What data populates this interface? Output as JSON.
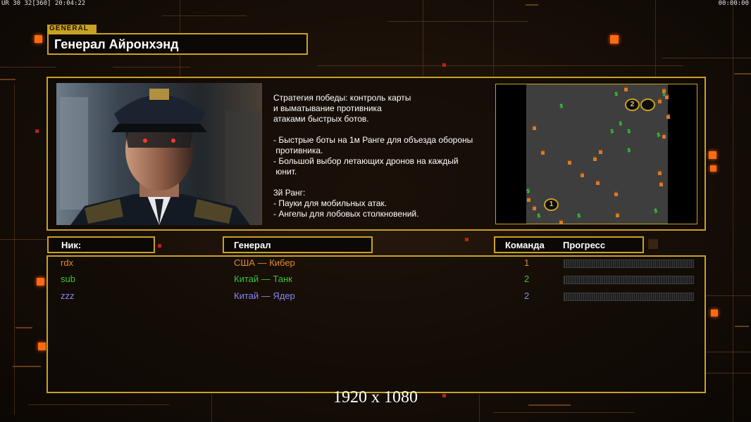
{
  "overlay": {
    "fps_text": "UR 30 32[360] 20:04:22",
    "clock": "00:00:00",
    "resolution": "1920 x 1080"
  },
  "general": {
    "tag": "GENERAL",
    "name": "Генерал Айронхэнд",
    "portrait_icon": "general-portrait",
    "description": "Стратегия победы: контроль карты\nи выматывание противника\nатаками быстрых ботов.\n\n- Быстрые боты на 1м Ранге для объезда обороны\n противника.\n- Большой выбор летающих дронов на каждый\n юнит.\n\n3й Ранг:\n- Пауки для мобильных атак.\n- Ангелы для лобовых столкновений."
  },
  "minimap": {
    "start_positions": [
      "1",
      "2"
    ],
    "money_symbol": "$"
  },
  "table": {
    "headers": {
      "nick": "Ник:",
      "general": "Генерал",
      "team": "Команда",
      "progress": "Прогресс"
    },
    "rows": [
      {
        "nick": "rdx",
        "general": "США — Кибер",
        "team": "1",
        "color": "#e08a2a",
        "progress": 0
      },
      {
        "nick": "sub",
        "general": "Китай — Танк",
        "team": "2",
        "color": "#3ec43e",
        "progress": 0
      },
      {
        "nick": "zzz",
        "general": "Китай — Ядер",
        "team": "2",
        "color": "#8a86f0",
        "progress": 0
      }
    ]
  },
  "colors": {
    "accent": "#c9a124",
    "glow": "#ff6a12"
  }
}
